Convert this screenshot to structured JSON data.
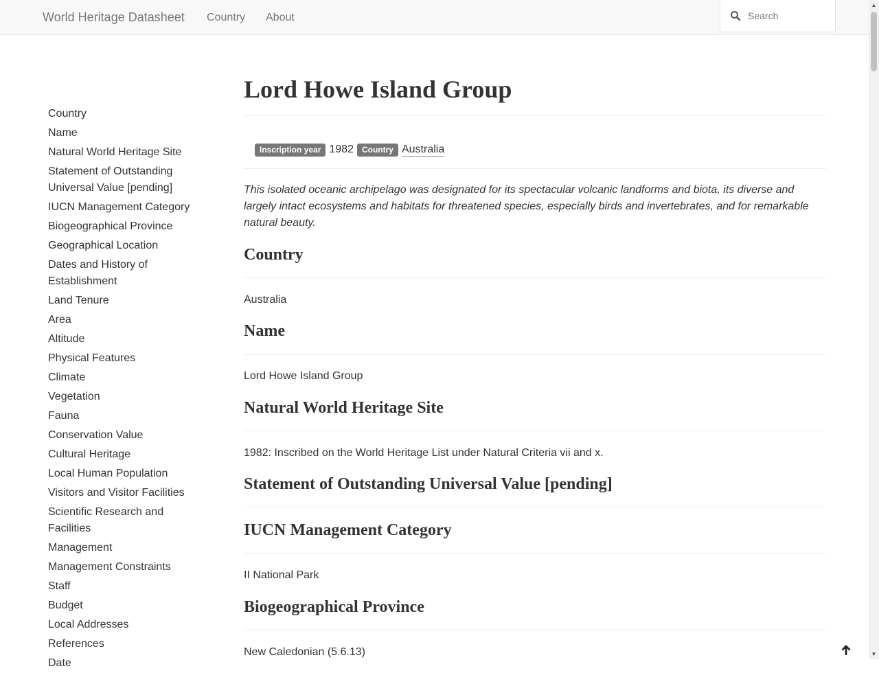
{
  "navbar": {
    "brand": "World Heritage Datasheet",
    "links": [
      "Country",
      "About"
    ],
    "search_placeholder": "Search"
  },
  "toc": [
    "Country",
    "Name",
    "Natural World Heritage Site",
    "Statement of Outstanding Universal Value [pending]",
    "IUCN Management Category",
    "Biogeographical Province",
    "Geographical Location",
    "Dates and History of Establishment",
    "Land Tenure",
    "Area",
    "Altitude",
    "Physical Features",
    "Climate",
    "Vegetation",
    "Fauna",
    "Conservation Value",
    "Cultural Heritage",
    "Local Human Population",
    "Visitors and Visitor Facilities",
    "Scientific Research and Facilities",
    "Management",
    "Management Constraints",
    "Staff",
    "Budget",
    "Local Addresses",
    "References",
    "Date"
  ],
  "page": {
    "title": "Lord Howe Island Group",
    "meta": {
      "inscription_label": "Inscription year",
      "inscription_year": "1982",
      "country_label": "Country",
      "country_value": "Australia"
    },
    "summary": "This isolated oceanic archipelago was designated for its spectacular volcanic landforms and biota, its diverse and largely intact ecosystems and habitats for threatened species, especially birds and invertebrates, and for remarkable natural beauty."
  },
  "sections": [
    {
      "heading": "Country",
      "body": "Australia"
    },
    {
      "heading": "Name",
      "body": "Lord Howe Island Group"
    },
    {
      "heading": "Natural World Heritage Site",
      "body": "1982: Inscribed on the World Heritage List under Natural Criteria vii and x."
    },
    {
      "heading": "Statement of Outstanding Universal Value [pending]",
      "body": ""
    },
    {
      "heading": "IUCN Management Category",
      "body": "II National Park"
    },
    {
      "heading": "Biogeographical Province",
      "body": "New Caledonian (5.6.13)"
    }
  ],
  "icons": {
    "search": "search-icon",
    "back_to_top": "arrow-up-icon"
  }
}
